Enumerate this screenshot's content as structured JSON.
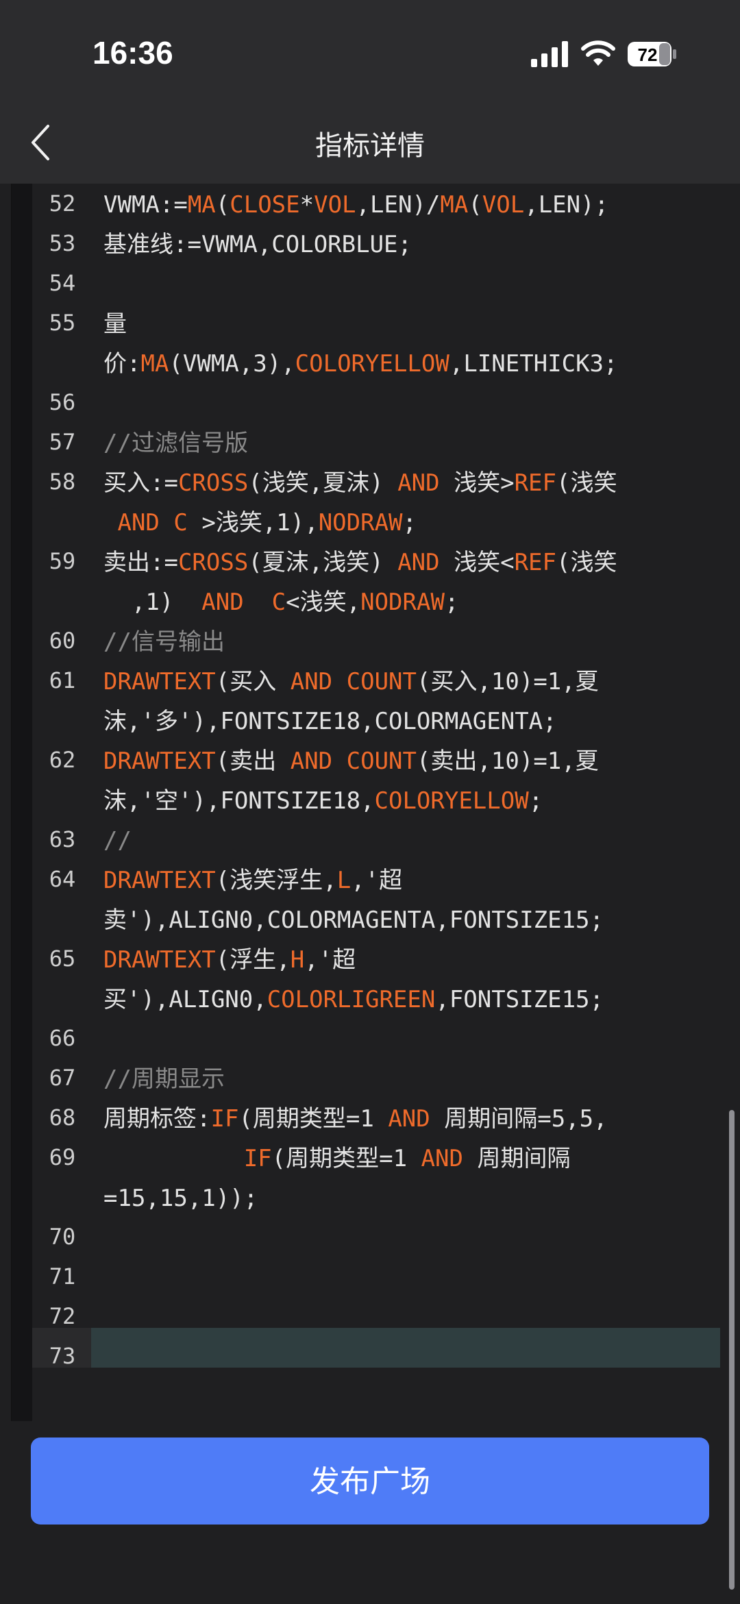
{
  "status": {
    "time": "16:36",
    "battery": "72"
  },
  "nav": {
    "title": "指标详情"
  },
  "colors": {
    "keyword": "#ef6b2b",
    "comment": "#8a8a8a",
    "button": "#4f7cf7"
  },
  "code_lines": [
    {
      "n": "52",
      "rows": [
        [
          [
            "VWMA:=",
            ""
          ],
          [
            "MA",
            "k"
          ],
          [
            "(",
            ""
          ],
          [
            "CLOSE",
            "k"
          ],
          [
            "*",
            ""
          ],
          [
            "VOL",
            "k"
          ],
          [
            ",LEN)/",
            ""
          ],
          [
            "MA",
            "k"
          ],
          [
            "(",
            ""
          ],
          [
            "VOL",
            "k"
          ],
          [
            ",LEN);",
            ""
          ]
        ]
      ]
    },
    {
      "n": "53",
      "rows": [
        [
          [
            "基准线:=VWMA,COLORBLUE;",
            ""
          ]
        ]
      ]
    },
    {
      "n": "54",
      "rows": [
        [
          [
            "",
            ""
          ]
        ]
      ]
    },
    {
      "n": "55",
      "rows": [
        [
          [
            "量",
            ""
          ]
        ],
        [
          [
            "价:",
            ""
          ],
          [
            "MA",
            "k"
          ],
          [
            "(VWMA,3),",
            ""
          ],
          [
            "COLORYELLOW",
            "k"
          ],
          [
            ",LINETHICK3;",
            ""
          ]
        ]
      ]
    },
    {
      "n": "56",
      "rows": [
        [
          [
            "",
            ""
          ]
        ]
      ]
    },
    {
      "n": "57",
      "rows": [
        [
          [
            "//过滤信号版",
            "c"
          ]
        ]
      ]
    },
    {
      "n": "58",
      "rows": [
        [
          [
            "买入:=",
            ""
          ],
          [
            "CROSS",
            "k"
          ],
          [
            "(浅笑,夏沫) ",
            ""
          ],
          [
            "AND",
            "k"
          ],
          [
            " 浅笑>",
            ""
          ],
          [
            "REF",
            "k"
          ],
          [
            "(浅笑",
            ""
          ]
        ],
        [
          [
            " ",
            ""
          ],
          [
            "AND",
            "k"
          ],
          [
            " ",
            ""
          ],
          [
            "C",
            "k"
          ],
          [
            " >浅笑,1),",
            ""
          ],
          [
            "NODRAW",
            "k"
          ],
          [
            ";",
            ""
          ]
        ]
      ]
    },
    {
      "n": "59",
      "rows": [
        [
          [
            "卖出:=",
            ""
          ],
          [
            "CROSS",
            "k"
          ],
          [
            "(夏沫,浅笑) ",
            ""
          ],
          [
            "AND",
            "k"
          ],
          [
            " 浅笑<",
            ""
          ],
          [
            "REF",
            "k"
          ],
          [
            "(浅笑",
            ""
          ]
        ],
        [
          [
            "  ,1)  ",
            ""
          ],
          [
            "AND",
            "k"
          ],
          [
            "  ",
            ""
          ],
          [
            "C",
            "k"
          ],
          [
            "<浅笑,",
            ""
          ],
          [
            "NODRAW",
            "k"
          ],
          [
            ";",
            ""
          ]
        ]
      ]
    },
    {
      "n": "60",
      "rows": [
        [
          [
            "//信号输出",
            "c"
          ]
        ]
      ]
    },
    {
      "n": "61",
      "rows": [
        [
          [
            "DRAWTEXT",
            "k"
          ],
          [
            "(买入 ",
            ""
          ],
          [
            "AND",
            "k"
          ],
          [
            " ",
            ""
          ],
          [
            "COUNT",
            "k"
          ],
          [
            "(买入,10)=1,夏",
            ""
          ]
        ],
        [
          [
            "沫,'多'),FONTSIZE18,COLORMAGENTA;",
            ""
          ]
        ]
      ]
    },
    {
      "n": "62",
      "rows": [
        [
          [
            "DRAWTEXT",
            "k"
          ],
          [
            "(卖出 ",
            ""
          ],
          [
            "AND",
            "k"
          ],
          [
            " ",
            ""
          ],
          [
            "COUNT",
            "k"
          ],
          [
            "(卖出,10)=1,夏",
            ""
          ]
        ],
        [
          [
            "沫,'空'),FONTSIZE18,",
            ""
          ],
          [
            "COLORYELLOW",
            "k"
          ],
          [
            ";",
            ""
          ]
        ]
      ]
    },
    {
      "n": "63",
      "rows": [
        [
          [
            "//",
            "c"
          ]
        ]
      ]
    },
    {
      "n": "64",
      "rows": [
        [
          [
            "DRAWTEXT",
            "k"
          ],
          [
            "(浅笑浮生,",
            ""
          ],
          [
            "L",
            "k"
          ],
          [
            ",'超",
            ""
          ]
        ],
        [
          [
            "卖'),ALIGN0,COLORMAGENTA,FONTSIZE15;",
            ""
          ]
        ]
      ]
    },
    {
      "n": "65",
      "rows": [
        [
          [
            "DRAWTEXT",
            "k"
          ],
          [
            "(浮生,",
            ""
          ],
          [
            "H",
            "k"
          ],
          [
            ",'超",
            ""
          ]
        ],
        [
          [
            "买'),ALIGN0,",
            ""
          ],
          [
            "COLORLIGREEN",
            "k"
          ],
          [
            ",FONTSIZE15;",
            ""
          ]
        ]
      ]
    },
    {
      "n": "66",
      "rows": [
        [
          [
            "",
            ""
          ]
        ]
      ]
    },
    {
      "n": "67",
      "rows": [
        [
          [
            "//周期显示",
            "c"
          ]
        ]
      ]
    },
    {
      "n": "68",
      "rows": [
        [
          [
            "周期标签:",
            ""
          ],
          [
            "IF",
            "k"
          ],
          [
            "(周期类型=1 ",
            ""
          ],
          [
            "AND",
            "k"
          ],
          [
            " 周期间隔=5,5,",
            ""
          ]
        ]
      ]
    },
    {
      "n": "69",
      "rows": [
        [
          [
            "          ",
            ""
          ],
          [
            "IF",
            "k"
          ],
          [
            "(周期类型=1 ",
            ""
          ],
          [
            "AND",
            "k"
          ],
          [
            " 周期间隔",
            ""
          ]
        ],
        [
          [
            "=15,15,1));",
            ""
          ]
        ]
      ]
    },
    {
      "n": "70",
      "rows": [
        [
          [
            "",
            ""
          ]
        ]
      ]
    },
    {
      "n": "71",
      "rows": [
        [
          [
            "",
            ""
          ]
        ]
      ]
    },
    {
      "n": "72",
      "rows": [
        [
          [
            "",
            ""
          ]
        ]
      ]
    },
    {
      "n": "73",
      "rows": [
        [
          [
            "",
            ""
          ]
        ]
      ]
    }
  ],
  "publish": {
    "label": "发布广场"
  }
}
